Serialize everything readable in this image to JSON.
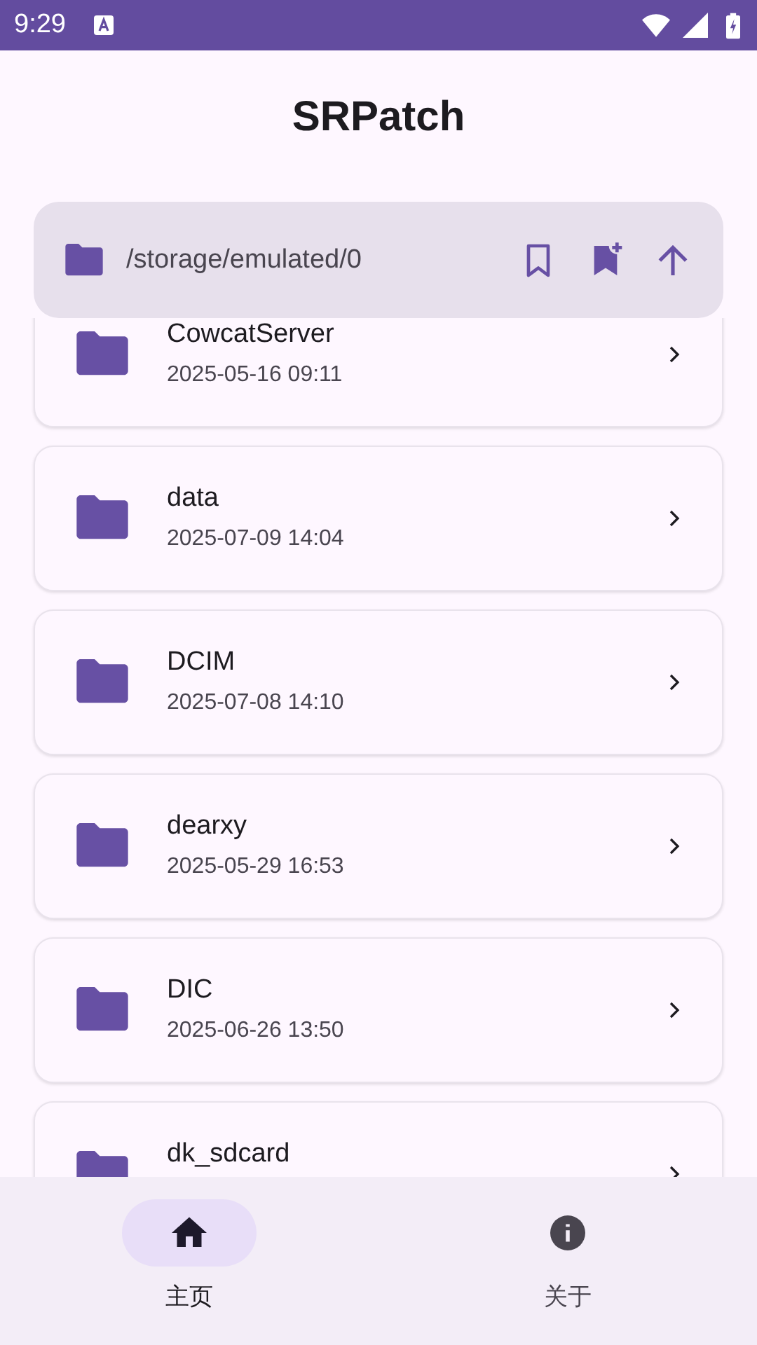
{
  "status_bar": {
    "time": "9:29"
  },
  "app_bar": {
    "title": "SRPatch"
  },
  "path_bar": {
    "path": "/storage/emulated/0"
  },
  "files": [
    {
      "name": "CowcatServer",
      "date": "2025-05-16 09:11"
    },
    {
      "name": "data",
      "date": "2025-07-09 14:04"
    },
    {
      "name": "DCIM",
      "date": "2025-07-08 14:10"
    },
    {
      "name": "dearxy",
      "date": "2025-05-29 16:53"
    },
    {
      "name": "DIC",
      "date": "2025-06-26 13:50"
    },
    {
      "name": "dk_sdcard"
    }
  ],
  "nav": [
    {
      "kind": "home",
      "label": "主页",
      "selected": true
    },
    {
      "kind": "info",
      "label": "关于",
      "selected": false
    }
  ]
}
